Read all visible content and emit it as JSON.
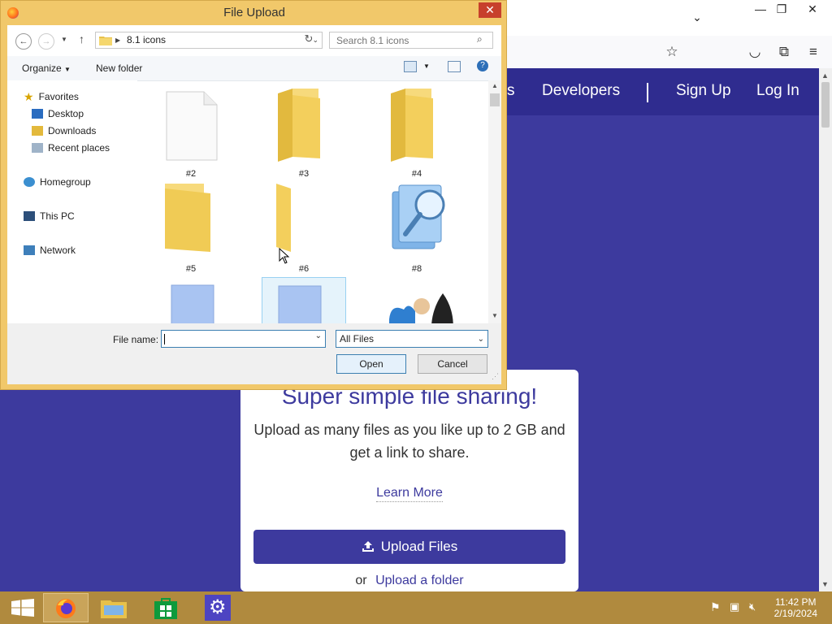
{
  "dialog": {
    "title": "File Upload",
    "address": {
      "folder": "8.1 icons"
    },
    "search": {
      "placeholder": "Search 8.1 icons"
    },
    "toolbar": {
      "organize_label": "Organize",
      "new_folder_label": "New folder"
    },
    "nav_pane": {
      "favorites": "Favorites",
      "desktop": "Desktop",
      "downloads": "Downloads",
      "recent_places": "Recent places",
      "homegroup": "Homegroup",
      "this_pc": "This PC",
      "network": "Network"
    },
    "files": [
      {
        "label": "#2",
        "icon": "blank-file-icon"
      },
      {
        "label": "#3",
        "icon": "folder-icon"
      },
      {
        "label": "#4",
        "icon": "folder-icon"
      },
      {
        "label": "#5",
        "icon": "folder-icon"
      },
      {
        "label": "#6",
        "icon": "folder-icon"
      },
      {
        "label": "#8",
        "icon": "search-files-icon"
      },
      {
        "label": "",
        "icon": "blue-pages-icon"
      },
      {
        "label": "",
        "icon": "blue-pages-icon"
      },
      {
        "label": "",
        "icon": "games-icon"
      }
    ],
    "file_name": {
      "label": "File name:",
      "value": ""
    },
    "file_type": {
      "value": "All Files"
    },
    "open_label": "Open",
    "cancel_label": "Cancel",
    "close_glyph": "✕"
  },
  "site": {
    "nav": {
      "partial_link": "s",
      "developers": "Developers",
      "sign_up": "Sign Up",
      "log_in": "Log In"
    },
    "hero": {
      "title": "Super simple file sharing!",
      "subtitle": "Upload as many files as you like up to 2 GB and get a link to share.",
      "learn_more": "Learn More",
      "upload_button": "Upload Files",
      "or_text": "or",
      "upload_folder": "Upload a folder"
    },
    "colors": {
      "brand": "#3d3a9e",
      "nav": "#2f2c8f"
    }
  },
  "taskbar": {
    "time": "11:42 PM",
    "date": "2/19/2024"
  }
}
